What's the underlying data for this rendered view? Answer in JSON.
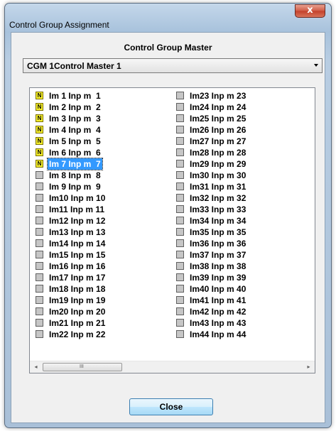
{
  "window": {
    "title": "Control Group Assignment",
    "close_glyph": "x"
  },
  "section_label": "Control Group Master",
  "master_select": {
    "value": "CGM 1Control Master 1"
  },
  "list": {
    "column1": [
      {
        "label": "Im 1 Inp m  1",
        "checked": true,
        "mark": "N"
      },
      {
        "label": "Im 2 Inp m  2",
        "checked": true,
        "mark": "N"
      },
      {
        "label": "Im 3 Inp m  3",
        "checked": true,
        "mark": "N"
      },
      {
        "label": "Im 4 Inp m  4",
        "checked": true,
        "mark": "N"
      },
      {
        "label": "Im 5 Inp m  5",
        "checked": true,
        "mark": "N"
      },
      {
        "label": "Im 6 Inp m  6",
        "checked": true,
        "mark": "N"
      },
      {
        "label": "Im 7 Inp m  7",
        "checked": true,
        "mark": "N",
        "selected": true
      },
      {
        "label": "Im 8 Inp m  8",
        "checked": false,
        "mark": ""
      },
      {
        "label": "Im 9 Inp m  9",
        "checked": false,
        "mark": ""
      },
      {
        "label": "Im10 Inp m 10",
        "checked": false,
        "mark": ""
      },
      {
        "label": "Im11 Inp m 11",
        "checked": false,
        "mark": ""
      },
      {
        "label": "Im12 Inp m 12",
        "checked": false,
        "mark": ""
      },
      {
        "label": "Im13 Inp m 13",
        "checked": false,
        "mark": ""
      },
      {
        "label": "Im14 Inp m 14",
        "checked": false,
        "mark": ""
      },
      {
        "label": "Im15 Inp m 15",
        "checked": false,
        "mark": ""
      },
      {
        "label": "Im16 Inp m 16",
        "checked": false,
        "mark": ""
      },
      {
        "label": "Im17 Inp m 17",
        "checked": false,
        "mark": ""
      },
      {
        "label": "Im18 Inp m 18",
        "checked": false,
        "mark": ""
      },
      {
        "label": "Im19 Inp m 19",
        "checked": false,
        "mark": ""
      },
      {
        "label": "Im20 Inp m 20",
        "checked": false,
        "mark": ""
      },
      {
        "label": "Im21 Inp m 21",
        "checked": false,
        "mark": ""
      },
      {
        "label": "Im22 Inp m 22",
        "checked": false,
        "mark": ""
      }
    ],
    "column2": [
      {
        "label": "Im23 Inp m 23",
        "checked": false,
        "mark": ""
      },
      {
        "label": "Im24 Inp m 24",
        "checked": false,
        "mark": ""
      },
      {
        "label": "Im25 Inp m 25",
        "checked": false,
        "mark": ""
      },
      {
        "label": "Im26 Inp m 26",
        "checked": false,
        "mark": ""
      },
      {
        "label": "Im27 Inp m 27",
        "checked": false,
        "mark": ""
      },
      {
        "label": "Im28 Inp m 28",
        "checked": false,
        "mark": ""
      },
      {
        "label": "Im29 Inp m 29",
        "checked": false,
        "mark": ""
      },
      {
        "label": "Im30 Inp m 30",
        "checked": false,
        "mark": ""
      },
      {
        "label": "Im31 Inp m 31",
        "checked": false,
        "mark": ""
      },
      {
        "label": "Im32 Inp m 32",
        "checked": false,
        "mark": ""
      },
      {
        "label": "Im33 Inp m 33",
        "checked": false,
        "mark": ""
      },
      {
        "label": "Im34 Inp m 34",
        "checked": false,
        "mark": ""
      },
      {
        "label": "Im35 Inp m 35",
        "checked": false,
        "mark": ""
      },
      {
        "label": "Im36 Inp m 36",
        "checked": false,
        "mark": ""
      },
      {
        "label": "Im37 Inp m 37",
        "checked": false,
        "mark": ""
      },
      {
        "label": "Im38 Inp m 38",
        "checked": false,
        "mark": ""
      },
      {
        "label": "Im39 Inp m 39",
        "checked": false,
        "mark": ""
      },
      {
        "label": "Im40 Inp m 40",
        "checked": false,
        "mark": ""
      },
      {
        "label": "Im41 Inp m 41",
        "checked": false,
        "mark": ""
      },
      {
        "label": "Im42 Inp m 42",
        "checked": false,
        "mark": ""
      },
      {
        "label": "Im43 Inp m 43",
        "checked": false,
        "mark": ""
      },
      {
        "label": "Im44 Inp m 44",
        "checked": false,
        "mark": ""
      }
    ]
  },
  "scrollbar": {
    "left_glyph": "◂",
    "right_glyph": "▸",
    "grip_glyph": "III"
  },
  "close_button": {
    "label": "Close"
  },
  "colors": {
    "checked_fill": "#f5ef2d",
    "selection": "#3399ff"
  },
  "icons": {
    "window_close": "close-icon",
    "dropdown": "chevron-down-icon"
  }
}
